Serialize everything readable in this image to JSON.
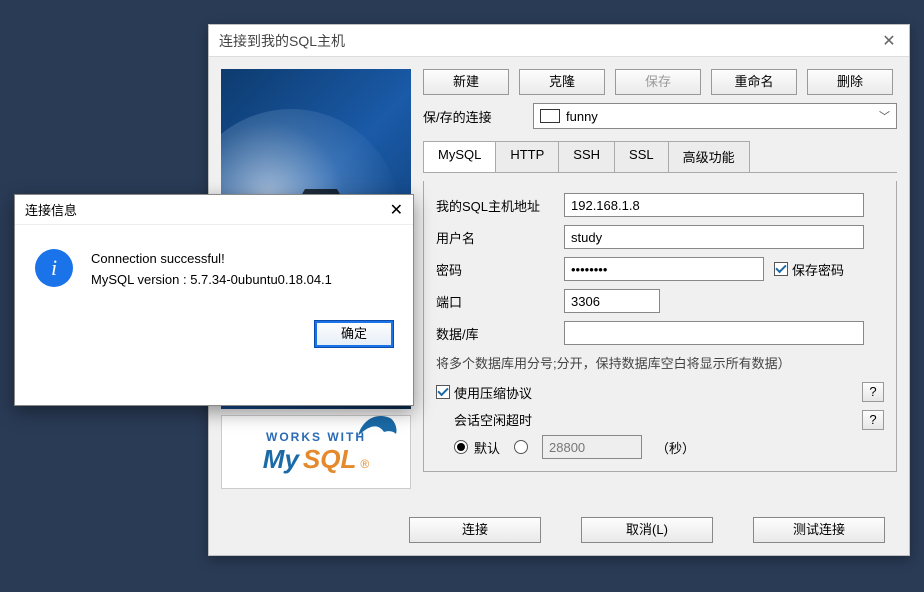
{
  "mainWindow": {
    "title": "连接到我的SQL主机",
    "toolbar": {
      "new": "新建",
      "clone": "克隆",
      "save": "保存",
      "rename": "重命名",
      "delete": "删除"
    },
    "savedConnLabel": "保/存的连接",
    "savedConnValue": "funny",
    "tabs": [
      "MySQL",
      "HTTP",
      "SSH",
      "SSL",
      "高级功能"
    ],
    "fields": {
      "hostLabel": "我的SQL主机地址",
      "hostValue": "192.168.1.8",
      "userLabel": "用户名",
      "userValue": "study",
      "pwdLabel": "密码",
      "pwdValue": "••••••••",
      "savePwd": "保存密码",
      "portLabel": "端口",
      "portValue": "3306",
      "dbLabel": "数据/库",
      "dbValue": "",
      "dbHint": "将多个数据库用分号;分开，保持数据库空白将显示所有数据）",
      "compress": "使用压缩协议",
      "idleLabel": "会话空闲超时",
      "radioDefault": "默认",
      "idleCustomValue": "28800",
      "secondsUnit": "（秒）"
    },
    "bottom": {
      "connect": "连接",
      "cancel": "取消(L)",
      "test": "测试连接"
    },
    "worksWith": "WORKS WITH",
    "mysqlMy": "My",
    "mysqlSQL": "SQL",
    "mysqlR": "®"
  },
  "modal": {
    "title": "连接信息",
    "line1": "Connection successful!",
    "line2": "MySQL version : 5.7.34-0ubuntu0.18.04.1",
    "ok": "确定"
  }
}
